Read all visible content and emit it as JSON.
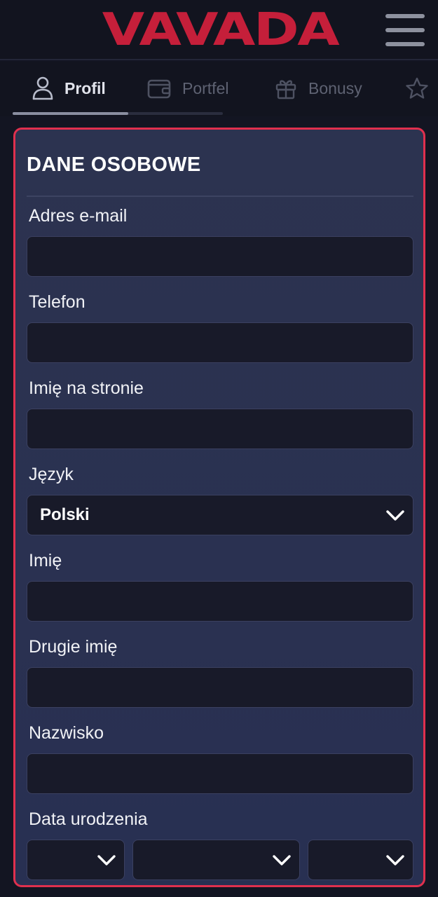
{
  "header": {
    "logo_text": "VAVADA",
    "brand_color": "#c51f3a"
  },
  "tabs": [
    {
      "label": "Profil",
      "icon": "user-icon",
      "active": true
    },
    {
      "label": "Portfel",
      "icon": "wallet-icon",
      "active": false
    },
    {
      "label": "Bonusy",
      "icon": "gift-icon",
      "active": false
    },
    {
      "label": "",
      "icon": "star-icon",
      "active": false
    }
  ],
  "card": {
    "title": "DANE OSOBOWE",
    "accent_color": "#e0304e",
    "fields": {
      "email": {
        "label": "Adres e-mail",
        "value": "",
        "placeholder": ""
      },
      "phone": {
        "label": "Telefon",
        "value": "",
        "placeholder": ""
      },
      "nickname": {
        "label": "Imię na stronie",
        "value": "",
        "placeholder": ""
      },
      "language": {
        "label": "Język",
        "value": "Polski"
      },
      "first_name": {
        "label": "Imię",
        "value": "",
        "placeholder": ""
      },
      "middle_name": {
        "label": "Drugie imię",
        "value": "",
        "placeholder": ""
      },
      "last_name": {
        "label": "Nazwisko",
        "value": "",
        "placeholder": ""
      },
      "birth_date": {
        "label": "Data urodzenia",
        "day": "",
        "month": "",
        "year": ""
      }
    }
  }
}
